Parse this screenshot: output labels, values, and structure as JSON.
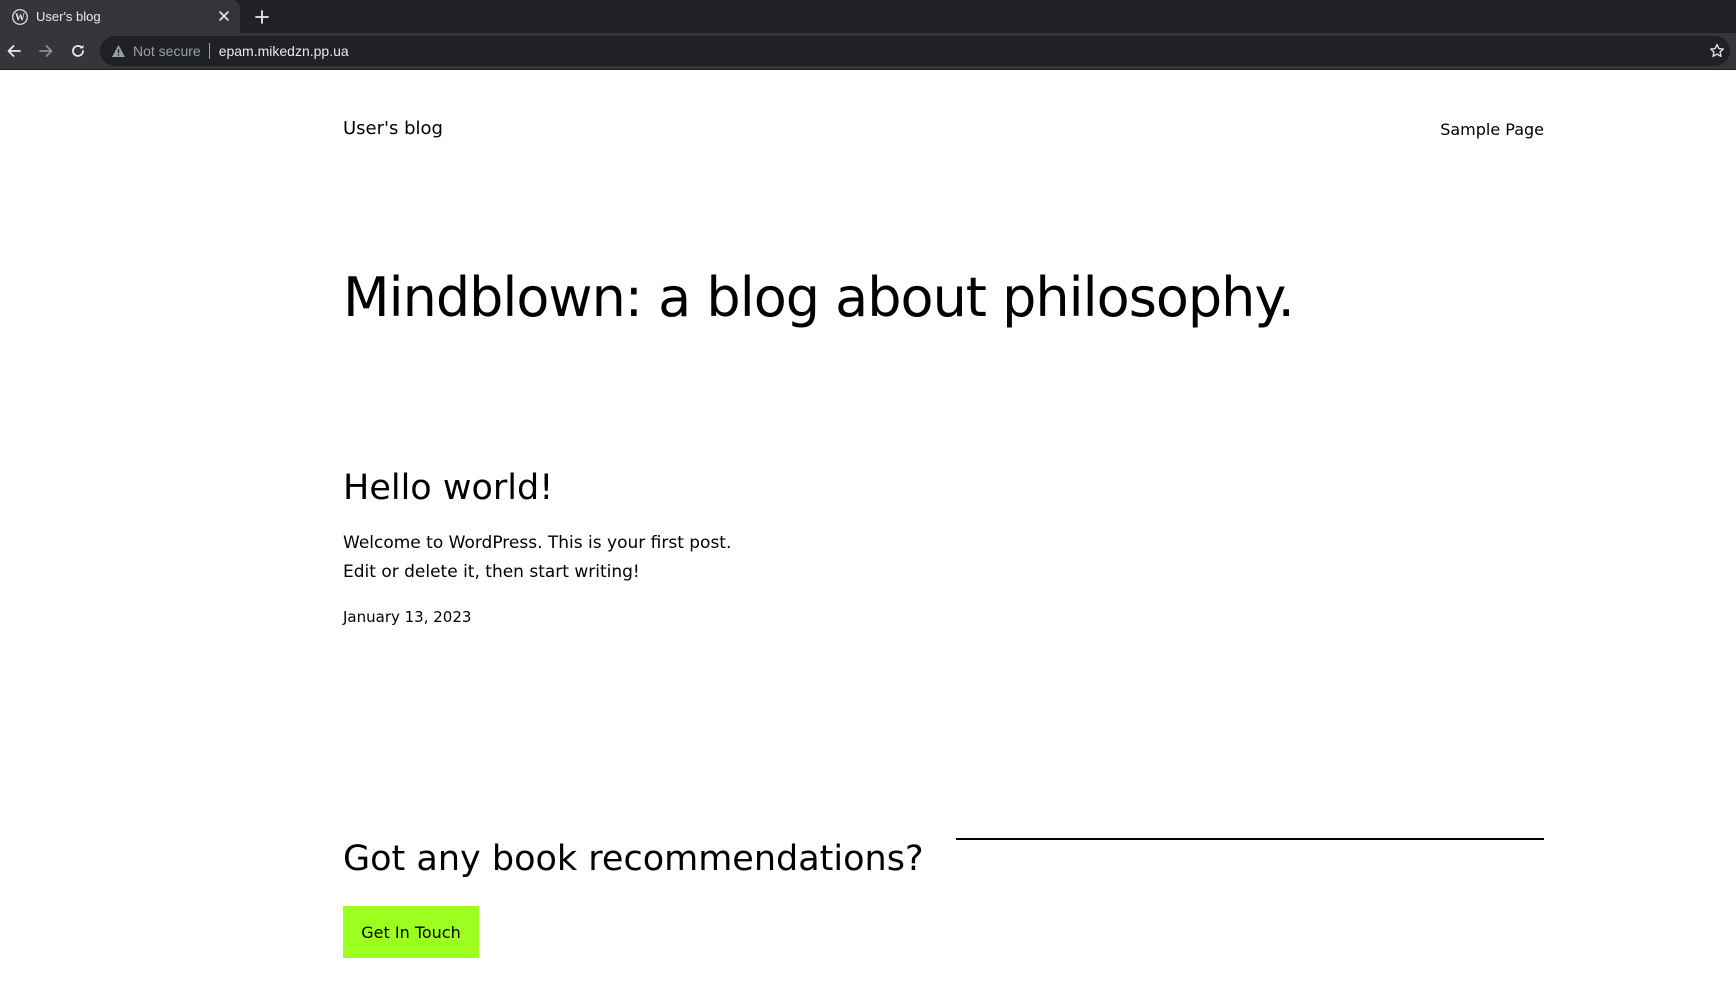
{
  "browser": {
    "tab": {
      "title": "User's blog",
      "favicon": "wordpress-icon"
    },
    "omnibox": {
      "security_label": "Not secure",
      "url": "epam.mikedzn.pp.ua"
    }
  },
  "site": {
    "title": "User's blog",
    "nav": [
      {
        "label": "Sample Page"
      }
    ]
  },
  "hero": {
    "title": "Mindblown: a blog about philosophy."
  },
  "post": {
    "title": "Hello world!",
    "excerpt_lines": [
      "Welcome to WordPress. This is your first post.",
      "Edit or delete it, then start writing!"
    ],
    "date": "January 13, 2023"
  },
  "cta": {
    "title": "Got any book recommendations?",
    "button_label": "Get In Touch",
    "button_color": "#9dff20"
  },
  "colors": {
    "chrome_dark": "#202124",
    "chrome_tab": "#35363a",
    "chrome_text": "#e8eaed",
    "page_bg": "#ffffff",
    "page_text": "#000000"
  }
}
